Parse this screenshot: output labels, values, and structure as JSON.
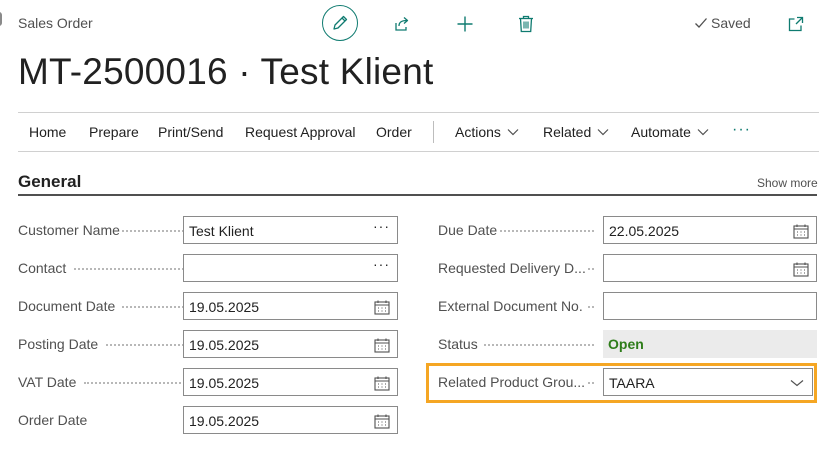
{
  "header": {
    "page_type": "Sales Order",
    "saved_label": "Saved",
    "title": "MT-2500016 · Test Klient",
    "icons": [
      "edit-icon",
      "share-icon",
      "plus-icon",
      "trash-icon",
      "check-icon",
      "popout-icon"
    ]
  },
  "action_bar": {
    "items": [
      "Home",
      "Prepare",
      "Print/Send",
      "Request Approval",
      "Order"
    ],
    "menus": [
      "Actions",
      "Related",
      "Automate"
    ],
    "more": "···"
  },
  "section": {
    "title": "General",
    "show_more": "Show more"
  },
  "fields_left": [
    {
      "label": "Customer Name",
      "value": "Test Klient"
    },
    {
      "label": "Contact",
      "value": ""
    },
    {
      "label": "Document Date",
      "value": "19.05.2025"
    },
    {
      "label": "Posting Date",
      "value": "19.05.2025"
    },
    {
      "label": "VAT Date",
      "value": "19.05.2025"
    },
    {
      "label": "Order Date",
      "value": "19.05.2025"
    }
  ],
  "fields_right": [
    {
      "label": "Due Date",
      "value": "22.05.2025"
    },
    {
      "label": "Requested Delivery D...",
      "value": ""
    },
    {
      "label": "External Document No.",
      "value": ""
    },
    {
      "label": "Status",
      "value": "Open"
    },
    {
      "label": "Related Product Grou...",
      "value": "TAARA"
    }
  ],
  "colors": {
    "accent": "#0f7b70",
    "status_open": "#2e7d1a",
    "highlight": "#f5a623"
  }
}
